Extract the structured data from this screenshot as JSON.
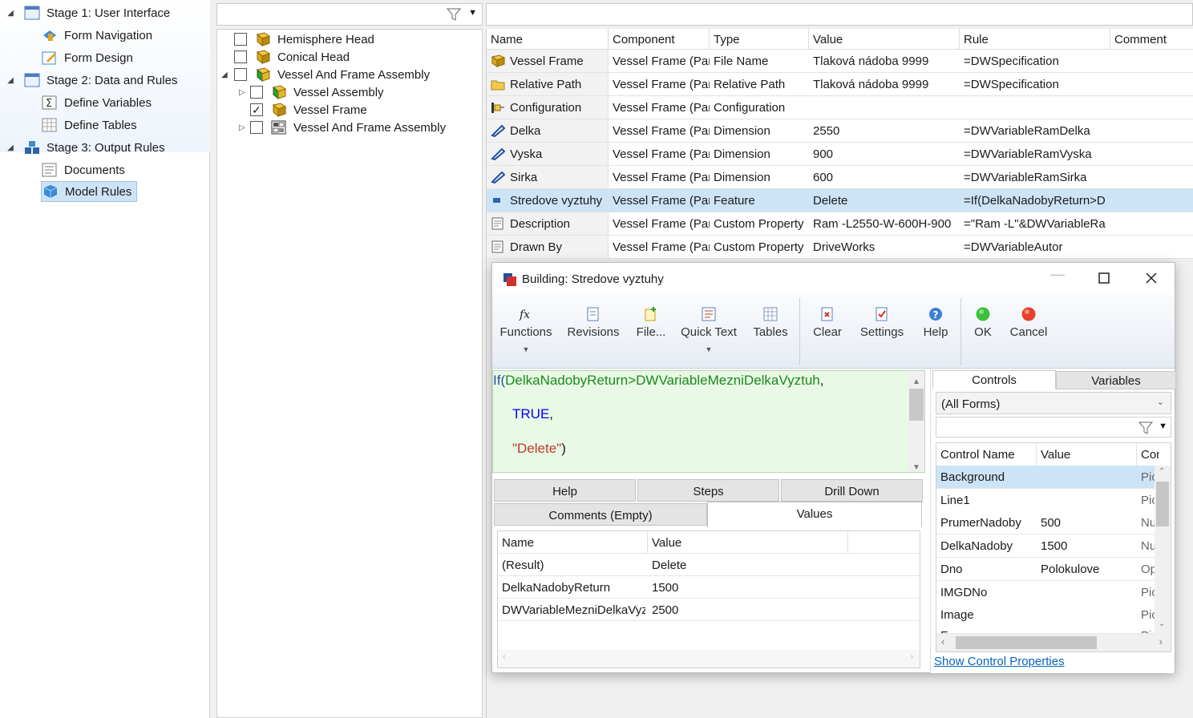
{
  "nav": {
    "items": [
      {
        "label": "Stage 1: User Interface",
        "icon": "window-icon",
        "level": 0
      },
      {
        "label": "Form Navigation",
        "icon": "navigation-icon",
        "level": 1
      },
      {
        "label": "Form Design",
        "icon": "form-design-icon",
        "level": 1
      },
      {
        "label": "Stage 2: Data and Rules",
        "icon": "data-icon",
        "level": 0
      },
      {
        "label": "Define Variables",
        "icon": "sigma-icon",
        "level": 1
      },
      {
        "label": "Define Tables",
        "icon": "table-icon",
        "level": 1
      },
      {
        "label": "Stage 3: Output Rules",
        "icon": "output-icon",
        "level": 0
      },
      {
        "label": "Documents",
        "icon": "documents-icon",
        "level": 1
      },
      {
        "label": "Model Rules",
        "icon": "model-rules-icon",
        "level": 1,
        "selected": true
      }
    ]
  },
  "tree": {
    "items": [
      {
        "label": "Hemisphere Head",
        "checked": false
      },
      {
        "label": "Conical Head",
        "checked": false
      },
      {
        "label": "Vessel And Frame Assembly",
        "checked": false,
        "expanded": true
      },
      {
        "label": "Vessel Assembly",
        "checked": false
      },
      {
        "label": "Vessel Frame",
        "checked": true
      },
      {
        "label": "Vessel And Frame Assembly",
        "checked": false
      }
    ]
  },
  "grid": {
    "headers": [
      "Name",
      "Component",
      "Type",
      "Value",
      "Rule",
      "Comment"
    ],
    "rows": [
      {
        "icon": "part-icon",
        "cells": [
          "Vessel Frame",
          "Vessel Frame (Part",
          "File Name",
          "Tlaková nádoba 9999",
          "=DWSpecification",
          ""
        ]
      },
      {
        "icon": "folder-icon",
        "cells": [
          "Relative Path",
          "Vessel Frame (Part",
          "Relative Path",
          "Tlaková nádoba 9999",
          "=DWSpecification",
          ""
        ]
      },
      {
        "icon": "configuration-icon",
        "cells": [
          "Configuration",
          "Vessel Frame (Part",
          "Configuration",
          "",
          "",
          ""
        ]
      },
      {
        "icon": "dimension-icon",
        "cells": [
          "Delka",
          "Vessel Frame (Part",
          "Dimension",
          "2550",
          "=DWVariableRamDelka",
          ""
        ]
      },
      {
        "icon": "dimension-icon",
        "cells": [
          "Vyska",
          "Vessel Frame (Part",
          "Dimension",
          "900",
          "=DWVariableRamVyska",
          ""
        ]
      },
      {
        "icon": "dimension-icon",
        "cells": [
          "Sirka",
          "Vessel Frame (Part",
          "Dimension",
          "600",
          "=DWVariableRamSirka",
          ""
        ]
      },
      {
        "icon": "feature-icon",
        "selected": true,
        "cells": [
          "Stredove vyztuhy",
          "Vessel Frame (Part",
          "Feature",
          "Delete",
          "=If(DelkaNadobyReturn>D",
          ""
        ]
      },
      {
        "icon": "custom-property-icon",
        "cells": [
          "Description",
          "Vessel Frame (Part",
          "Custom Property",
          "Ram -L2550-W-600H-900",
          "=\"Ram -L\"&DWVariableRa",
          ""
        ]
      },
      {
        "icon": "custom-property-icon",
        "cells": [
          "Drawn By",
          "Vessel Frame (Part",
          "Custom Property",
          "DriveWorks",
          "=DWVariableAutor",
          ""
        ]
      }
    ]
  },
  "dialog": {
    "title": "Building: Stredove vyztuhy",
    "ribbon": [
      {
        "label": "Functions",
        "icon": "fx-icon",
        "dropdown": true
      },
      {
        "label": "Revisions",
        "icon": "revisions-icon"
      },
      {
        "label": "File...",
        "icon": "file-icon"
      },
      {
        "label": "Quick Text",
        "icon": "quick-text-icon",
        "dropdown": true
      },
      {
        "label": "Tables",
        "icon": "tables-icon"
      },
      {
        "label": "Clear",
        "icon": "clear-icon"
      },
      {
        "label": "Settings",
        "icon": "settings-icon"
      },
      {
        "label": "Help",
        "icon": "help-icon"
      },
      {
        "label": "OK",
        "icon": "ok-icon"
      },
      {
        "label": "Cancel",
        "icon": "cancel-icon"
      }
    ],
    "rule": {
      "fn": "If(",
      "arg1": "DelkaNadobyReturn",
      "op": ">",
      "arg2": "DWVariableMezniDelkaVyztuh",
      "comma": ",",
      "true_kw": "TRUE",
      "true_comma": ",",
      "str": "\"Delete\"",
      "close": ")"
    },
    "tabs_row1": [
      "Help",
      "Steps",
      "Drill Down"
    ],
    "tabs_row2": [
      "Comments (Empty)",
      "Values"
    ],
    "values": {
      "headers": [
        "Name",
        "Value"
      ],
      "rows": [
        [
          "(Result)",
          "Delete"
        ],
        [
          "DelkaNadobyReturn",
          "1500"
        ],
        [
          "DWVariableMezniDelkaVyztuh",
          "2500"
        ]
      ]
    },
    "right": {
      "tabs": [
        "Controls",
        "Variables"
      ],
      "form_select": "(All Forms)",
      "headers": [
        "Control Name",
        "Value",
        "Control"
      ],
      "rows": [
        [
          "Background",
          "",
          "Picture"
        ],
        [
          "Line1",
          "",
          "Picture"
        ],
        [
          "PrumerNadoby",
          "500",
          "Numeric"
        ],
        [
          "DelkaNadoby",
          "1500",
          "Numeric"
        ],
        [
          "Dno",
          "Polokulove",
          "Option"
        ],
        [
          "IMGDNo",
          "",
          "Picture"
        ],
        [
          "Image",
          "",
          "Picture"
        ],
        [
          "Fr",
          "",
          "Pi"
        ]
      ],
      "link": "Show Control Properties"
    }
  },
  "colors": {
    "accent": "#0563c1",
    "selection": "#cde4f6",
    "editor_bg": "#e8f9e6",
    "keyword": "#0000ff",
    "string": "#c0392b",
    "identifier": "#1a8a1a"
  }
}
